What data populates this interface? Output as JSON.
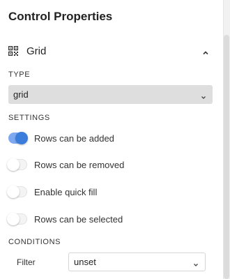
{
  "panel": {
    "title": "Control Properties"
  },
  "section": {
    "label": "Grid",
    "icon": "qr-grid-icon",
    "collapse_icon": "chevron-up-icon"
  },
  "type": {
    "label": "TYPE",
    "value": "grid"
  },
  "settings": {
    "label": "SETTINGS",
    "toggles": [
      {
        "label": "Rows can be added",
        "on": true
      },
      {
        "label": "Rows can be removed",
        "on": false
      },
      {
        "label": "Enable quick fill",
        "on": false
      },
      {
        "label": "Rows can be selected",
        "on": false
      }
    ]
  },
  "conditions": {
    "label": "CONDITIONS",
    "filter_label": "Filter",
    "filter_value": "unset"
  },
  "colors": {
    "toggle_on_track": "#7ea9f0",
    "toggle_on_knob": "#3b7ddb",
    "select_bg": "#dedede"
  }
}
